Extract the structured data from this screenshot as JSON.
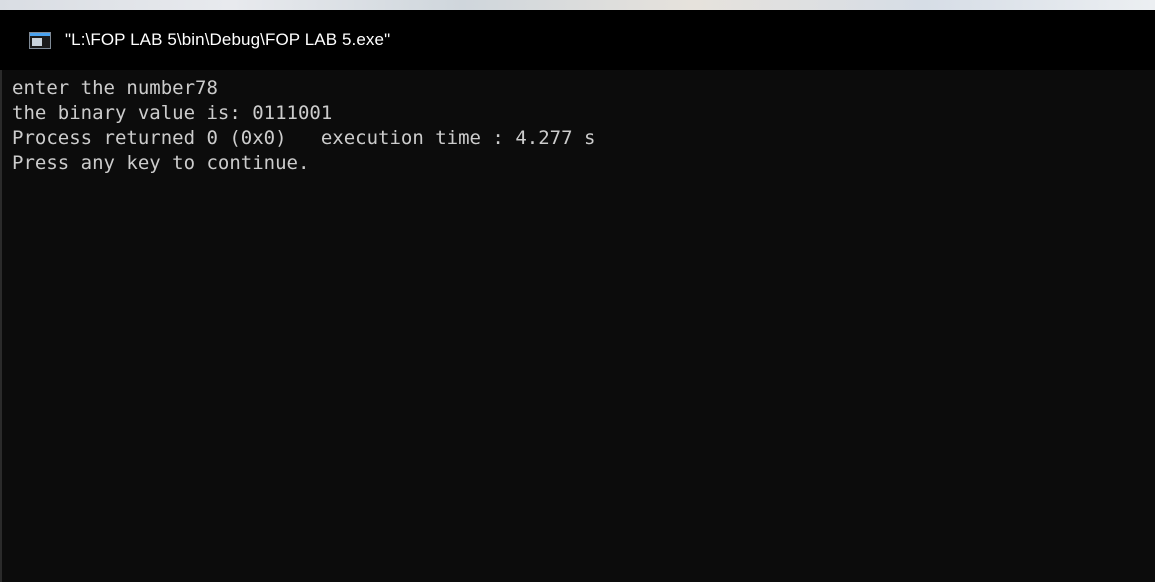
{
  "window": {
    "title": "\"L:\\FOP LAB 5\\bin\\Debug\\FOP LAB 5.exe\"",
    "icon": "console-app-icon"
  },
  "console": {
    "lines": [
      "enter the number78",
      "the binary value is: 0111001",
      "Process returned 0 (0x0)   execution time : 4.277 s",
      "Press any key to continue."
    ]
  },
  "colors": {
    "background": "#0c0c0c",
    "title_bar": "#000000",
    "text": "#cccccc",
    "title_text": "#ffffff"
  }
}
